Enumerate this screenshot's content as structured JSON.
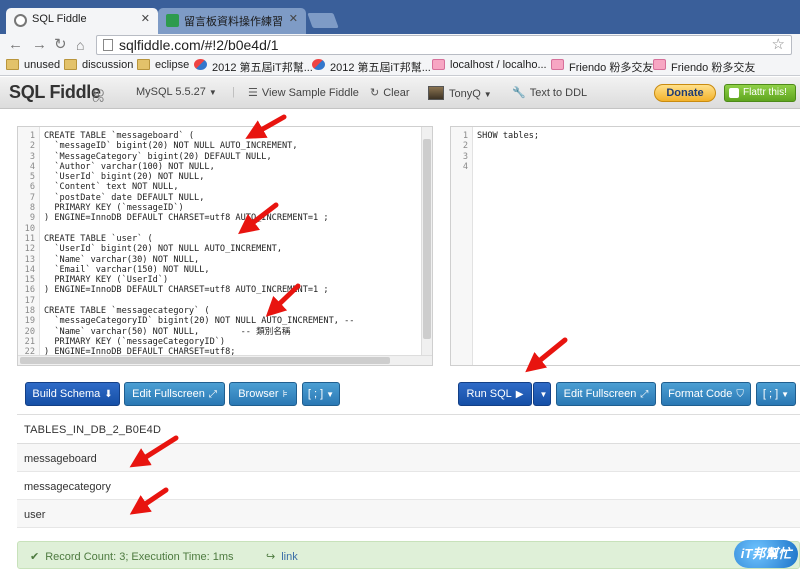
{
  "browser": {
    "tabs": [
      {
        "title": "SQL Fiddle",
        "active": true
      },
      {
        "title": "留言板資料操作練習",
        "active": false
      }
    ],
    "address": "sqlfiddle.com/#!2/b0e4d/1",
    "bookmarks": [
      {
        "label": "unused",
        "icon": "folder-icon"
      },
      {
        "label": "discussion",
        "icon": "folder-icon"
      },
      {
        "label": "eclipse",
        "icon": "folder-icon"
      },
      {
        "label": "2012 第五屆iT邦幫...",
        "icon": "gem-icon"
      },
      {
        "label": "2012 第五屆iT邦幫...",
        "icon": "gem-icon"
      },
      {
        "label": "localhost / localho...",
        "icon": "pma-icon"
      },
      {
        "label": "Friendo 粉多交友",
        "icon": "friendo-icon"
      },
      {
        "label": "Friendo 粉多交友",
        "icon": "friendo-icon"
      }
    ]
  },
  "nav": {
    "brand": "SQL Fiddle",
    "db_version": "MySQL 5.5.27",
    "view_sample": "View Sample Fiddle",
    "clear": "Clear",
    "user": "TonyQ",
    "text_to_ddl": "Text to DDL",
    "donate": "Donate",
    "flattr": "Flattr this!"
  },
  "schema_editor": {
    "line_numbers": [
      "1",
      "2",
      "3",
      "4",
      "5",
      "6",
      "7",
      "8",
      "9",
      "10",
      "11",
      "12",
      "13",
      "14",
      "15",
      "16",
      "17",
      "18",
      "19",
      "20",
      "21",
      "22"
    ],
    "lines": [
      "CREATE TABLE `messageboard` (",
      "  `messageID` bigint(20) NOT NULL AUTO_INCREMENT,",
      "  `MessageCategory` bigint(20) DEFAULT NULL,",
      "  `Author` varchar(100) NOT NULL,",
      "  `UserId` bigint(20) NOT NULL,",
      "  `Content` text NOT NULL,",
      "  `postDate` date DEFAULT NULL,",
      "  PRIMARY KEY (`messageID`)",
      ") ENGINE=InnoDB DEFAULT CHARSET=utf8 AUTO_INCREMENT=1 ;",
      "",
      "CREATE TABLE `user` (",
      "  `UserId` bigint(20) NOT NULL AUTO_INCREMENT,",
      "  `Name` varchar(30) NOT NULL,",
      "  `Email` varchar(150) NOT NULL,",
      "  PRIMARY KEY (`UserId`)",
      ") ENGINE=InnoDB DEFAULT CHARSET=utf8 AUTO_INCREMENT=1 ;",
      "",
      "CREATE TABLE `messagecategory` (",
      "  `messageCategoryID` bigint(20) NOT NULL AUTO_INCREMENT, --",
      "  `Name` varchar(50) NOT NULL,        -- 類別名稱",
      "  PRIMARY KEY (`messageCategoryID`)",
      ") ENGINE=InnoDB DEFAULT CHARSET=utf8;"
    ]
  },
  "query_editor": {
    "line_numbers": [
      "1",
      "2",
      "3",
      "4"
    ],
    "lines": [
      "SHOW tables;",
      "",
      "",
      ""
    ]
  },
  "buttons": {
    "build_schema": "Build Schema",
    "edit_fullscreen_left": "Edit Fullscreen",
    "browser": "Browser",
    "terminator_left": "[ ; ]",
    "run_sql": "Run SQL",
    "edit_fullscreen_right": "Edit Fullscreen",
    "format_code": "Format Code",
    "terminator_right": "[ ; ]"
  },
  "results": {
    "header": "TABLES_IN_DB_2_B0E4D",
    "rows": [
      "messageboard",
      "messagecategory",
      "user"
    ]
  },
  "status": {
    "text": "Record Count: 3; Execution Time: 1ms",
    "link": "link"
  },
  "watermark": "iT邦幫忙",
  "colors": {
    "tab_bar": "#3a5f9a",
    "primary_button": "#154fa6",
    "info_button": "#2a78b4",
    "success_bg": "#dff0d8",
    "arrow": "#e8140f"
  }
}
